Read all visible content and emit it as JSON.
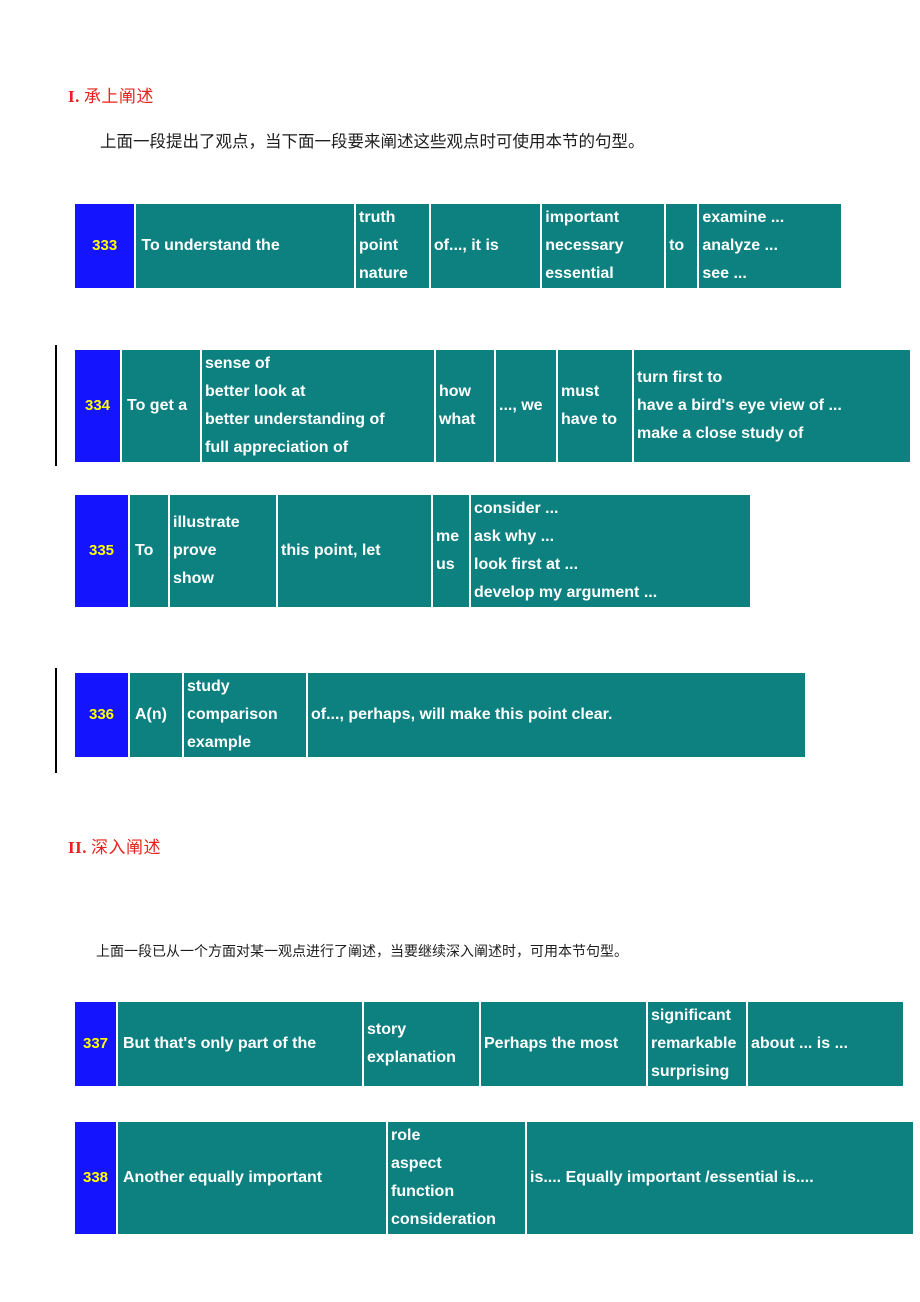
{
  "document": {
    "sections": [
      {
        "roman": "I.",
        "title": "承上阐述",
        "intro": "上面一段提出了观点，当下面一段要来阐述这些观点时可使用本节的句型。"
      },
      {
        "roman": "II.",
        "title": "深入阐述",
        "intro": "上面一段已从一个方面对某一观点进行了阐述，当要继续深入阐述时，可用本节句型。"
      }
    ],
    "patterns": [
      {
        "id": "333",
        "number": "333",
        "cells": [
          "To understand the",
          "truth\npoint\nnature",
          "of..., it is",
          "important\nnecessary\nessential",
          "to",
          "examine ...\nanalyze ...\nsee ..."
        ]
      },
      {
        "id": "334",
        "number": "334",
        "cells": [
          "To get a",
          "sense of\nbetter look at\nbetter understanding of\nfull appreciation of",
          "how\nwhat",
          "..., we",
          "must\nhave to",
          "turn first to\nhave a bird's eye view of ...\nmake a close study of"
        ]
      },
      {
        "id": "335",
        "number": "335",
        "cells": [
          "To",
          "illustrate\nprove\nshow",
          "this point, let",
          "me\nus",
          "consider ...\nask why ...\nlook first at ...\ndevelop my argument ..."
        ]
      },
      {
        "id": "336",
        "number": "336",
        "cells": [
          "A(n)",
          "study\ncomparison\nexample",
          "of..., perhaps, will make this point clear."
        ]
      },
      {
        "id": "337",
        "number": "337",
        "cells": [
          "But that's only part of the",
          "story\nexplanation",
          "Perhaps the most",
          "significant\nremarkable\nsurprising",
          "about ... is ..."
        ]
      },
      {
        "id": "338",
        "number": "338",
        "cells": [
          "Another equally important",
          "role\naspect\nfunction\nconsideration",
          "is.... Equally important /essential is...."
        ]
      }
    ],
    "colors": {
      "cell_bg": "#0d8080",
      "number_bg": "#1414ff",
      "number_fg": "#ffff00",
      "heading_fg": "#e8221c",
      "cell_fg": "#ffffff"
    }
  }
}
